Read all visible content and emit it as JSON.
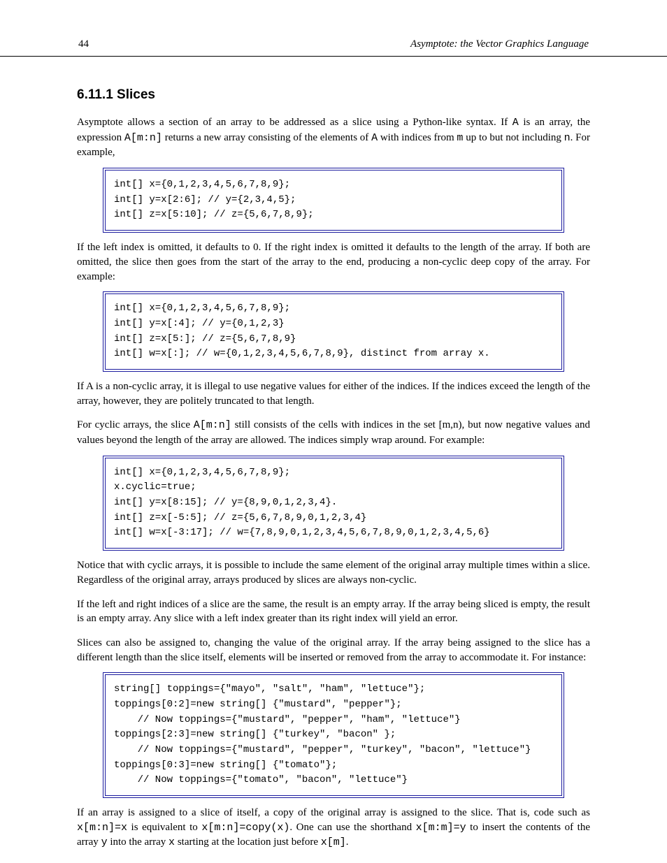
{
  "header": {
    "page": "44",
    "title": "Asymptote: the Vector Graphics Language"
  },
  "sec1": {
    "num": "6.11.1 Slices",
    "p1_a": "Asymptote allows a section of an array to be addressed as a slice using a Python-like syntax. If ",
    "p1_tt": "A",
    "p1_b": " is an array, the expression ",
    "p1_tt2": "A[m:n]",
    "p1_c": " returns a new array consisting of the elements of ",
    "p1_tt3": "A",
    "p1_d": " with indices from ",
    "p1_tt4": "m",
    "p1_e": " up to but not including ",
    "p1_tt5": "n",
    "p1_f": ". For example,"
  },
  "code1": "int[] x={0,1,2,3,4,5,6,7,8,9};\nint[] y=x[2:6]; // y={2,3,4,5};\nint[] z=x[5:10]; // z={5,6,7,8,9};",
  "p2": "If the left index is omitted, it defaults to 0.  If the right index is omitted it defaults to the length of the array.  If both are omitted, the slice then goes from the start of the array to the end, producing a non-cyclic deep copy of the array.  For example:",
  "code2": "int[] x={0,1,2,3,4,5,6,7,8,9};\nint[] y=x[:4]; // y={0,1,2,3}\nint[] z=x[5:]; // z={5,6,7,8,9}\nint[] w=x[:]; // w={0,1,2,3,4,5,6,7,8,9}, distinct from array x.",
  "p3": "If A is a non-cyclic array, it is illegal to use negative values for either of the indices. If the indices exceed the length of the array, however, they are politely truncated to that length.",
  "p4_a": "For cyclic arrays, the slice ",
  "p4_tt1": "A[m:n]",
  "p4_b": " still consists of the cells with indices in the set [",
  "p4_m": "m",
  "p4_c": ",",
  "p4_n": "n",
  "p4_d": "), but now negative values and values beyond the length of the array are allowed. The indices simply wrap around. For example:",
  "code3": "int[] x={0,1,2,3,4,5,6,7,8,9};\nx.cyclic=true;\nint[] y=x[8:15]; // y={8,9,0,1,2,3,4}.\nint[] z=x[-5:5]; // z={5,6,7,8,9,0,1,2,3,4}\nint[] w=x[-3:17]; // w={7,8,9,0,1,2,3,4,5,6,7,8,9,0,1,2,3,4,5,6}",
  "p5": "Notice that with cyclic arrays, it is possible to include the same element of the original array multiple times within a slice. Regardless of the original array, arrays produced by slices are always non-cyclic.",
  "p6_a": "If the left and right indices of a slice are the same, the result is an empty array. If the array being sliced is empty, the result is an empty array. Any slice with a left index greater than its right index will yield an error.",
  "p7_a": "Slices can also be assigned to, changing the value of the original array. If the array being assigned to the slice has a different length than the slice itself, elements will be inserted or removed from the array to accommodate it. For instance:",
  "code4": "string[] toppings={\"mayo\", \"salt\", \"ham\", \"lettuce\"};\ntoppings[0:2]=new string[] {\"mustard\", \"pepper\"};\n    // Now toppings={\"mustard\", \"pepper\", \"ham\", \"lettuce\"}\ntoppings[2:3]=new string[] {\"turkey\", \"bacon\" };\n    // Now toppings={\"mustard\", \"pepper\", \"turkey\", \"bacon\", \"lettuce\"}\ntoppings[0:3]=new string[] {\"tomato\"};\n    // Now toppings={\"tomato\", \"bacon\", \"lettuce\"}",
  "p8_a": "If an array is assigned to a slice of itself, a copy of the original array is assigned to the slice.  That is, code such as ",
  "p8_tt": "x[m:n]=x",
  "p8_b": " is equivalent to ",
  "p8_tt2": "x[m:n]=copy(x)",
  "p8_c": ". One can use the shorthand ",
  "p8_tt3": "x[m:m]=y",
  "p8_d": " to insert the contents of the array ",
  "p8_tt4": "y",
  "p8_e": " into the array ",
  "p8_tt5": "x",
  "p8_f": " starting at the location just before ",
  "p8_tt6": "x[m]",
  "p8_g": "."
}
